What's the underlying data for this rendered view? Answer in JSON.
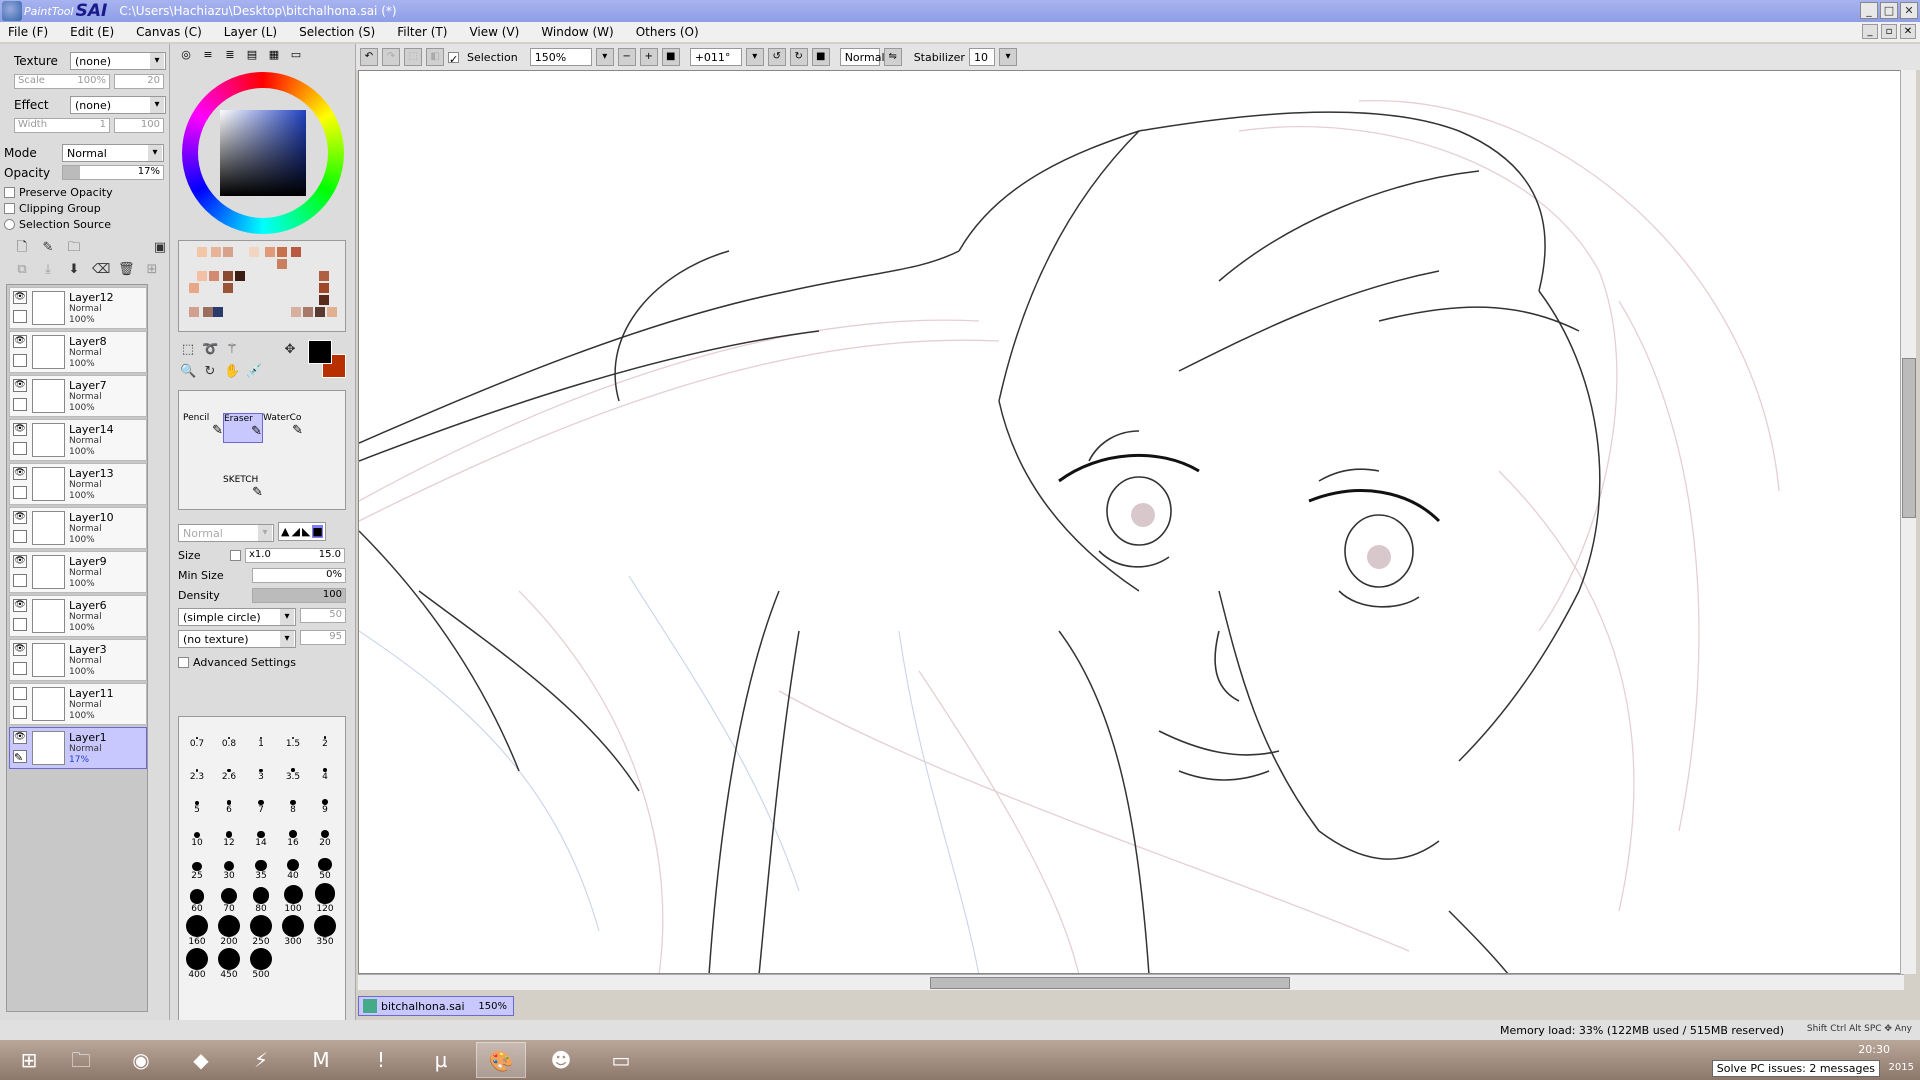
{
  "title": {
    "brand": "PaintTool",
    "brand2": "SAI",
    "path": "C:\\Users\\Hachiazu\\Desktop\\bitchalhona.sai (*)"
  },
  "menu": [
    "File (F)",
    "Edit (E)",
    "Canvas (C)",
    "Layer (L)",
    "Selection (S)",
    "Filter (T)",
    "View (V)",
    "Window (W)",
    "Others (O)"
  ],
  "left": {
    "texture_label": "Texture",
    "texture_value": "(none)",
    "scale_label": "Scale",
    "scale_value": "100%",
    "scale_num": "20",
    "effect_label": "Effect",
    "effect_value": "(none)",
    "width_label": "Width",
    "width_value": "1",
    "width_num": "100",
    "mode_label": "Mode",
    "mode_value": "Normal",
    "opacity_label": "Opacity",
    "opacity_value": "17%",
    "preserve_opacity": "Preserve Opacity",
    "clipping_group": "Clipping Group",
    "selection_source": "Selection Source"
  },
  "layers": [
    {
      "name": "Layer12",
      "mode": "Normal",
      "opacity": "100%",
      "visible": true
    },
    {
      "name": "Layer8",
      "mode": "Normal",
      "opacity": "100%",
      "visible": true
    },
    {
      "name": "Layer7",
      "mode": "Normal",
      "opacity": "100%",
      "visible": true
    },
    {
      "name": "Layer14",
      "mode": "Normal",
      "opacity": "100%",
      "visible": true
    },
    {
      "name": "Layer13",
      "mode": "Normal",
      "opacity": "100%",
      "visible": true
    },
    {
      "name": "Layer10",
      "mode": "Normal",
      "opacity": "100%",
      "visible": true
    },
    {
      "name": "Layer9",
      "mode": "Normal",
      "opacity": "100%",
      "visible": true
    },
    {
      "name": "Layer6",
      "mode": "Normal",
      "opacity": "100%",
      "visible": true
    },
    {
      "name": "Layer3",
      "mode": "Normal",
      "opacity": "100%",
      "visible": true
    },
    {
      "name": "Layer11",
      "mode": "Normal",
      "opacity": "100%",
      "visible": false
    },
    {
      "name": "Layer1",
      "mode": "Normal",
      "opacity": "17%",
      "visible": true,
      "selected": true
    }
  ],
  "brushes": [
    {
      "name": "Pencil"
    },
    {
      "name": "Eraser",
      "selected": true
    },
    {
      "name": "WaterCo"
    },
    {
      "name": "SKETCH"
    }
  ],
  "brushprops": {
    "mode": "Normal",
    "size_label": "Size",
    "size_mult": "x1.0",
    "size_value": "15.0",
    "minsize_label": "Min Size",
    "minsize_value": "0%",
    "density_label": "Density",
    "density_value": "100",
    "shape": "(simple circle)",
    "shape_num": "50",
    "texture": "(no texture)",
    "texture_num": "95",
    "advanced": "Advanced Settings"
  },
  "brush_sizes": [
    "0.7",
    "0.8",
    "1",
    "1.5",
    "2",
    "2.3",
    "2.6",
    "3",
    "3.5",
    "4",
    "5",
    "6",
    "7",
    "8",
    "9",
    "10",
    "12",
    "14",
    "16",
    "20",
    "25",
    "30",
    "35",
    "40",
    "50",
    "60",
    "70",
    "80",
    "100",
    "120",
    "160",
    "200",
    "250",
    "300",
    "350",
    "400",
    "450",
    "500"
  ],
  "toolbar": {
    "selection": "Selection",
    "zoom": "150%",
    "angle": "+011°",
    "mode": "Normal",
    "stabilizer_label": "Stabilizer",
    "stabilizer_value": "10"
  },
  "doc": {
    "name": "bitchalhona.sai",
    "zoom": "150%"
  },
  "status": {
    "memory": "Memory load: 33% (122MB used / 515MB reserved)",
    "keys": "Shift Ctrl Alt SPC ✥ Any"
  },
  "tray": {
    "time": "20:30",
    "notice": "Solve PC issues: 2 messages",
    "year": "2015"
  },
  "colors": {
    "fg": "#000000",
    "bg": "#b83000",
    "accent": "#c8c8ff"
  }
}
